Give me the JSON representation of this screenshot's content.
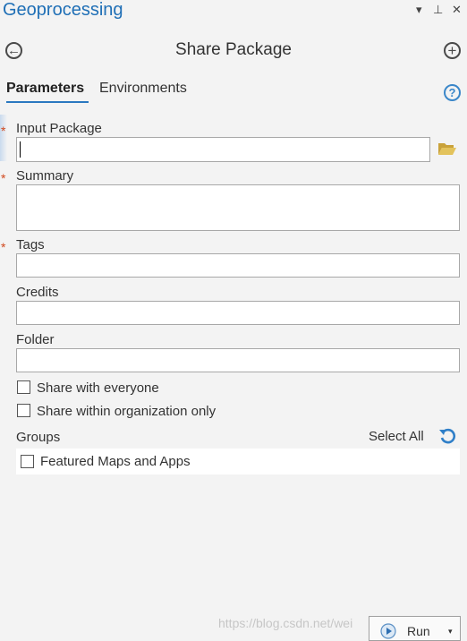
{
  "pane": {
    "title": "Geoprocessing",
    "controls": [
      "▾",
      "⊥",
      "✕"
    ]
  },
  "tool": {
    "title": "Share Package",
    "back_glyph": "←",
    "add_glyph": "+"
  },
  "tabs": [
    {
      "label": "Parameters",
      "active": true
    },
    {
      "label": "Environments",
      "active": false
    }
  ],
  "help_glyph": "?",
  "required_marker": "*",
  "fields": {
    "input_package": {
      "label": "Input Package",
      "value": "",
      "required": true
    },
    "summary": {
      "label": "Summary",
      "value": "",
      "required": true
    },
    "tags": {
      "label": "Tags",
      "value": "",
      "required": true
    },
    "credits": {
      "label": "Credits",
      "value": "",
      "required": false
    },
    "folder": {
      "label": "Folder",
      "value": "",
      "required": false
    }
  },
  "options": {
    "share_everyone": {
      "label": "Share with everyone",
      "checked": false
    },
    "share_org": {
      "label": "Share within organization only",
      "checked": false
    }
  },
  "groups": {
    "label": "Groups",
    "select_all_label": "Select All",
    "items": [
      {
        "label": "Featured Maps and Apps",
        "checked": false
      }
    ]
  },
  "run": {
    "label": "Run",
    "dropdown_glyph": "▾"
  },
  "watermark": "https://blog.csdn.net/wei",
  "colors": {
    "accent_blue": "#1f6fb6",
    "required_red": "#d0481d",
    "folder_yellow": "#d9b44a"
  },
  "icons": {
    "back": "back-arrow-icon",
    "add": "add-icon",
    "help": "help-icon",
    "browse": "folder-open-icon",
    "refresh": "refresh-icon",
    "run": "run-icon"
  }
}
